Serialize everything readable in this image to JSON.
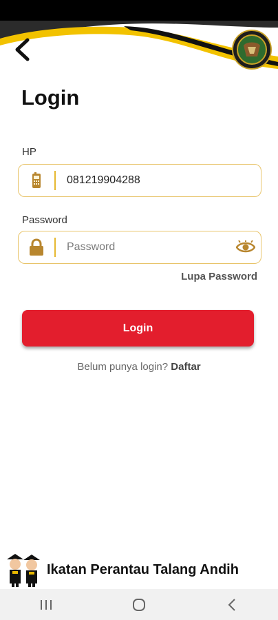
{
  "header": {
    "back_label": "back",
    "emblem_icon": "emblem-logo"
  },
  "page": {
    "title": "Login"
  },
  "form": {
    "hp_label": "HP",
    "hp_value": "081219904288",
    "hp_icon": "phone-icon",
    "password_label": "Password",
    "password_placeholder": "Password",
    "password_icon": "lock-icon",
    "show_password_icon": "eye-icon",
    "forgot_label": "Lupa Password",
    "submit_label": "Login"
  },
  "register": {
    "prompt": "Belum punya login?",
    "link_label": "Daftar"
  },
  "footer": {
    "brand_text": "Ikatan Perantau Talang Andih"
  },
  "system_nav": {
    "recent_icon": "recent-apps-icon",
    "home_icon": "home-icon",
    "back_icon": "back-icon"
  },
  "colors": {
    "accent_gold": "#f2c200",
    "primary_red": "#e31e2d",
    "field_border": "#e8c46a"
  }
}
